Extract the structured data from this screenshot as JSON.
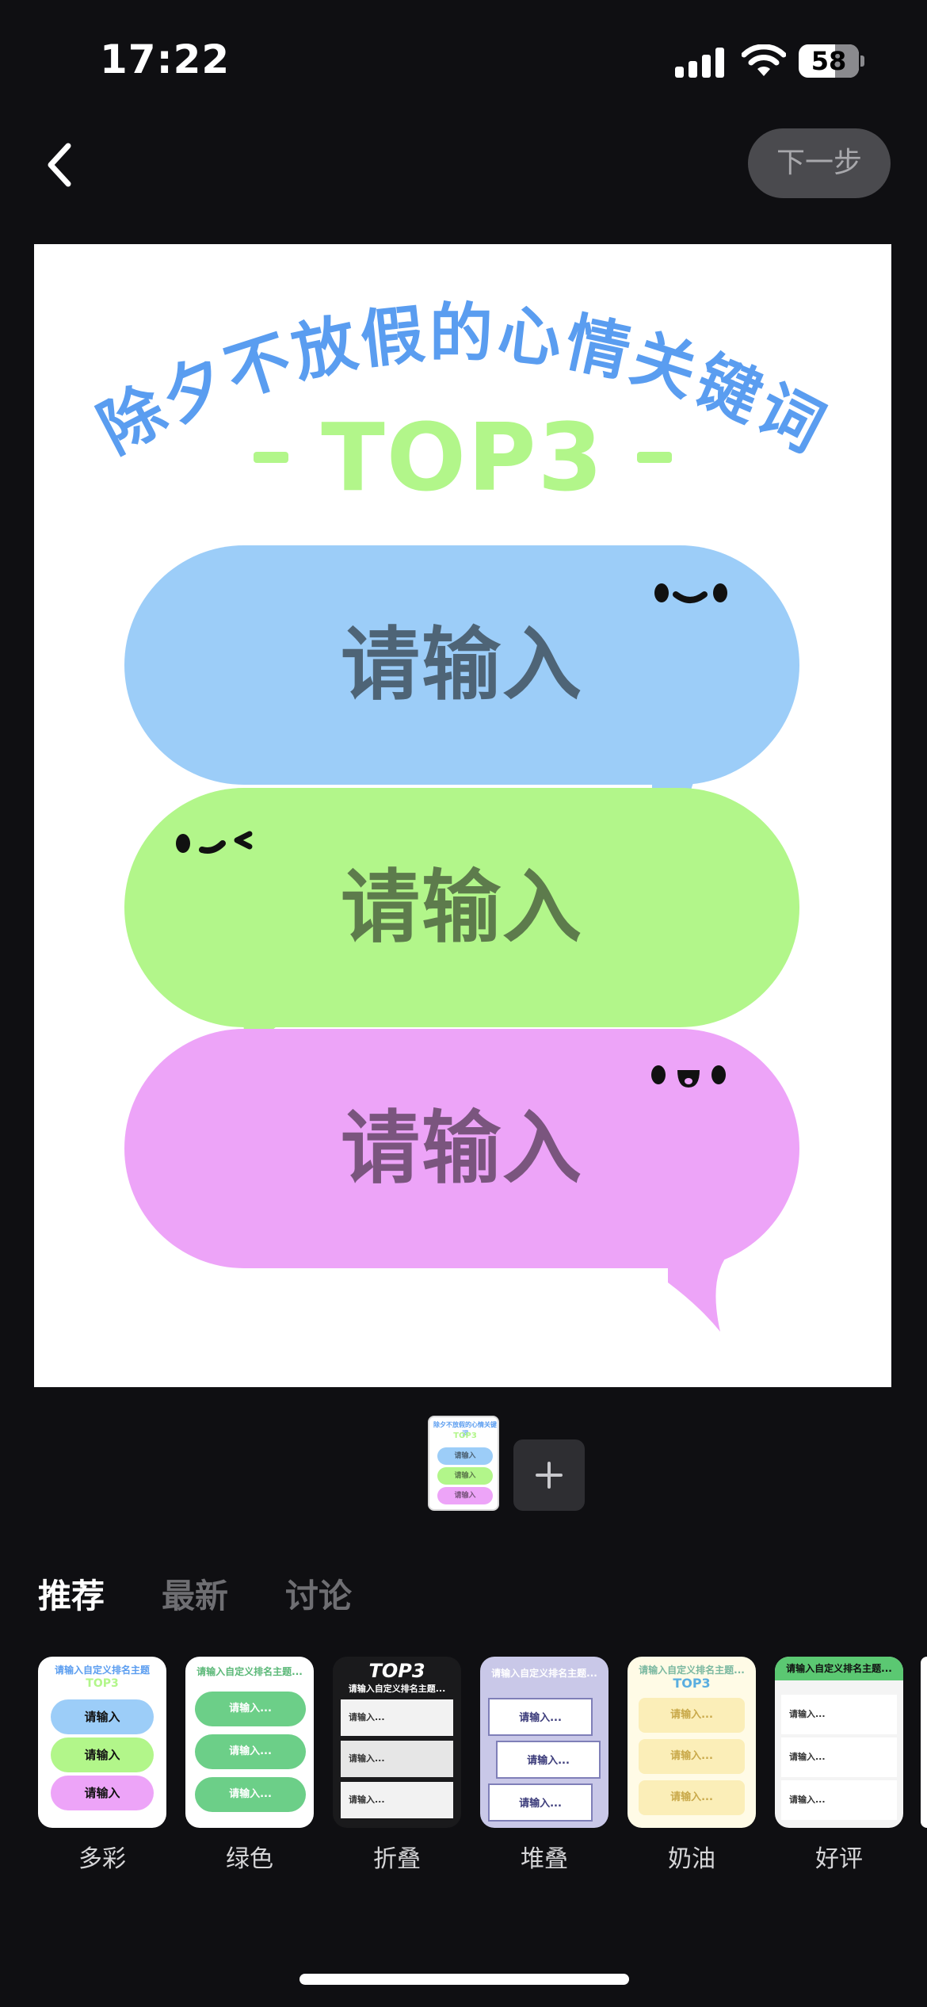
{
  "status_bar": {
    "time": "17:22",
    "battery": "58"
  },
  "nav": {
    "next_label": "下一步"
  },
  "poster": {
    "title": "除夕不放假的心情关键词",
    "subtitle": "TOP3",
    "bubbles": [
      {
        "text": "请输入",
        "color": "#9ccdf8",
        "text_color": "#4e6476"
      },
      {
        "text": "请输入",
        "color": "#b2f68a",
        "text_color": "#5d7b4c"
      },
      {
        "text": "请输入",
        "color": "#eda4f8",
        "text_color": "#7a557e"
      }
    ],
    "title_color": "#5a9df0",
    "subtitle_color": "#b2f68a"
  },
  "pages": {
    "thumb_items": [
      "请输入",
      "请输入",
      "请输入"
    ],
    "add_icon": "plus-icon"
  },
  "tabs": [
    {
      "label": "推荐",
      "active": true
    },
    {
      "label": "最新",
      "active": false
    },
    {
      "label": "讨论",
      "active": false
    }
  ],
  "templates": [
    {
      "label": "多彩",
      "header": "请输入自定义排名主题",
      "items": [
        "请输入",
        "请输入",
        "请输入"
      ]
    },
    {
      "label": "绿色",
      "header": "请输入自定义排名主题...",
      "items": [
        "请输入...",
        "请输入...",
        "请输入..."
      ]
    },
    {
      "label": "折叠",
      "header": "TOP3",
      "sub": "请输入自定义排名主题...",
      "items": [
        "请输入...",
        "请输入...",
        "请输入..."
      ]
    },
    {
      "label": "堆叠",
      "header": "请输入自定义排名主题...",
      "items": [
        "请输入...",
        "请输入...",
        "请输入..."
      ]
    },
    {
      "label": "奶油",
      "header": "请输入自定义排名主题...",
      "sub": "TOP3",
      "items": [
        "请输入...",
        "请输入...",
        "请输入..."
      ]
    },
    {
      "label": "好评",
      "header": "请输入自定义排名主题...",
      "items": [
        "请输入...",
        "请输入...",
        "请输入..."
      ]
    }
  ]
}
